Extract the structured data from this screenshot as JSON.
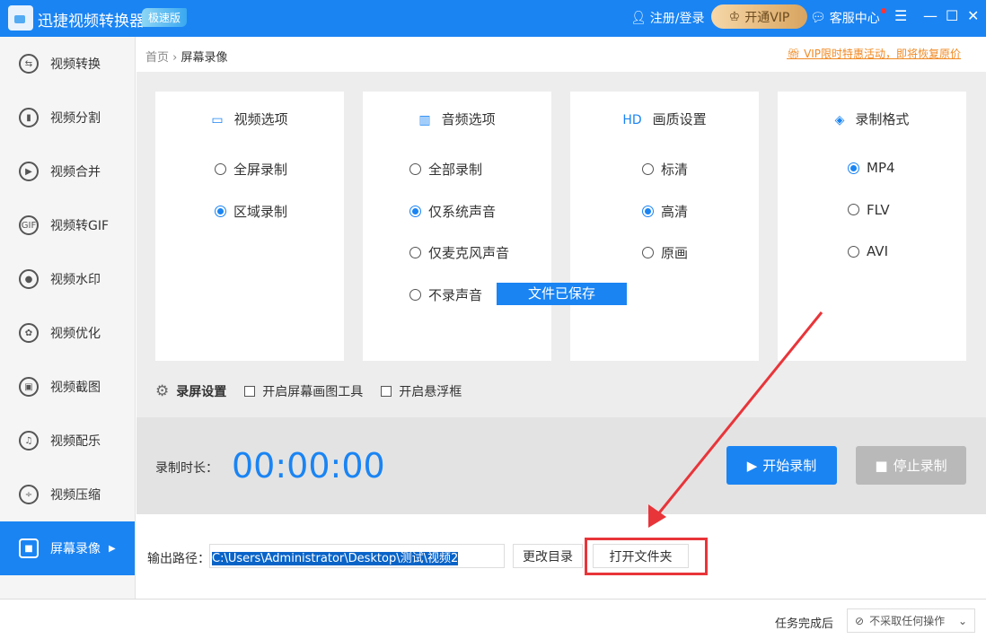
{
  "app": {
    "title": "迅捷视频转换器",
    "edition": "极速版",
    "login": "注册/登录",
    "vip": "开通VIP",
    "service": "客服中心"
  },
  "sidebar": {
    "items": [
      {
        "label": "视频转换",
        "icon": "⇆"
      },
      {
        "label": "视频分割",
        "icon": "▮"
      },
      {
        "label": "视频合并",
        "icon": "▶"
      },
      {
        "label": "视频转GIF",
        "icon": "GIF"
      },
      {
        "label": "视频水印",
        "icon": "●"
      },
      {
        "label": "视频优化",
        "icon": "✿"
      },
      {
        "label": "视频截图",
        "icon": "▣"
      },
      {
        "label": "视频配乐",
        "icon": "♫"
      },
      {
        "label": "视频压缩",
        "icon": "÷"
      },
      {
        "label": "屏幕录像",
        "icon": "■"
      }
    ]
  },
  "breadcrumb": {
    "home": "首页",
    "sep": "›",
    "current": "屏幕录像"
  },
  "promo": "VIP限时特惠活动，即将恢复原价",
  "cards": [
    {
      "title": "视频选项",
      "options": [
        "全屏录制",
        "区域录制"
      ],
      "selected": 1
    },
    {
      "title": "音频选项",
      "options": [
        "全部录制",
        "仅系统声音",
        "仅麦克风声音",
        "不录声音"
      ],
      "selected": 1
    },
    {
      "title": "画质设置",
      "options": [
        "标清",
        "高清",
        "原画"
      ],
      "selected": 1
    },
    {
      "title": "录制格式",
      "options": [
        "MP4",
        "FLV",
        "AVI"
      ],
      "selected": 0
    }
  ],
  "toast": "文件已保存",
  "settings": {
    "label": "录屏设置",
    "draw_tool": "开启屏幕画图工具",
    "float": "开启悬浮框"
  },
  "record": {
    "duration_label": "录制时长：",
    "time": "00:00:00",
    "start": "开始录制",
    "stop": "停止录制"
  },
  "output": {
    "label": "输出路径：",
    "path": "C:\\Users\\Administrator\\Desktop\\测试\\视频2",
    "change": "更改目录",
    "open": "打开文件夹"
  },
  "footer": {
    "after_label": "任务完成后",
    "action": "不采取任何操作"
  }
}
